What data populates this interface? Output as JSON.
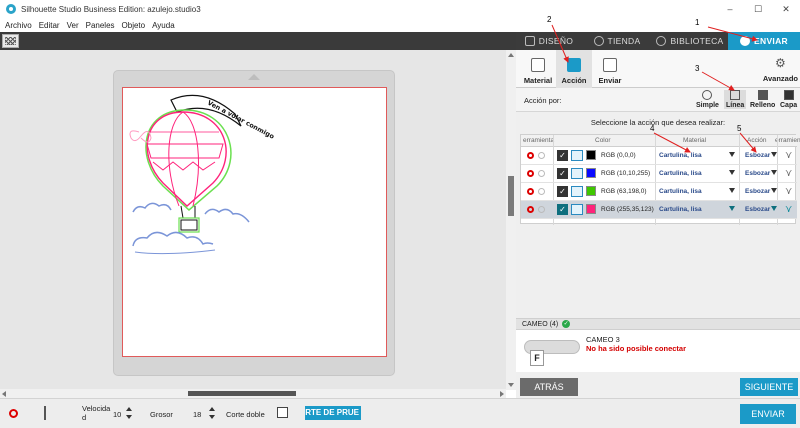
{
  "window": {
    "title": "Silhouette Studio Business Edition: azulejo.studio3",
    "minimize": "–",
    "maximize": "☐",
    "close": "✕"
  },
  "menu": [
    "Archivo",
    "Editar",
    "Ver",
    "Paneles",
    "Objeto",
    "Ayuda"
  ],
  "top_tabs": {
    "design": "DISEÑO",
    "store": "TIENDA",
    "library": "BIBLIOTECA",
    "send": "ENVIAR"
  },
  "sub_tabs": {
    "material": "Material",
    "action": "Acción",
    "send": "Enviar",
    "advanced": "Avanzado"
  },
  "action_by": {
    "label": "Acción por:",
    "modes": [
      "Simple",
      "Línea",
      "Relleno",
      "Capa"
    ]
  },
  "select_prompt": "Seleccione la acción que desea realizar:",
  "table": {
    "headers": [
      "erramienta",
      "Color",
      "Material",
      "Acción",
      "erramien"
    ],
    "rows": [
      {
        "swatch": "#000000",
        "color": "RGB (0,0,0)",
        "material": "Cartulina, lisa",
        "action": "Esbozar",
        "selected": false
      },
      {
        "swatch": "#0a0aff",
        "color": "RGB (10,10,255)",
        "material": "Cartulina, lisa",
        "action": "Esbozar",
        "selected": false
      },
      {
        "swatch": "#3fc600",
        "color": "RGB (63,198,0)",
        "material": "Cartulina, lisa",
        "action": "Esbozar",
        "selected": false
      },
      {
        "swatch": "#ff237b",
        "color": "RGB (255,35,123)",
        "material": "Cartulina, lisa",
        "action": "Esbozar",
        "selected": true
      }
    ]
  },
  "cameo": {
    "bar_label": "CAMEO (4)",
    "device_name": "CAMEO 3",
    "status": "No ha sido posible conectar",
    "badge": "F"
  },
  "nav": {
    "back": "ATRÁS",
    "next": "SIGUIENTE"
  },
  "bottom": {
    "speed_label_1": "Velocida",
    "speed_label_2": "d",
    "speed_value": "10",
    "thickness_label": "Grosor",
    "thickness_value": "18",
    "double_cut_label": "Corte doble",
    "test_button": "RTE DE PRUE",
    "send_button": "ENVIAR"
  },
  "annotations": [
    "1",
    "2",
    "3",
    "4",
    "5"
  ],
  "design_text": "Ven a volar conmigo",
  "colors": {
    "accent": "#1b9ac8",
    "dark_bar": "#3b3b3b",
    "error": "#d40000",
    "annotation": "#e02020"
  }
}
